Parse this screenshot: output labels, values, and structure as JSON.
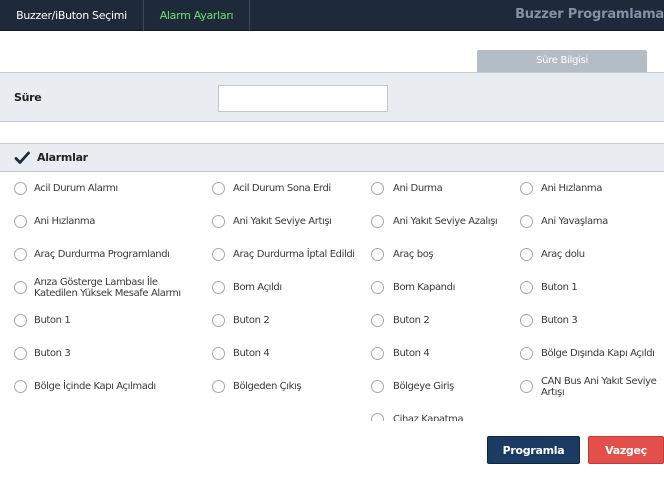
{
  "header": {
    "tabs": [
      {
        "label": "Buzzer/iButon Seçimi"
      },
      {
        "label": "Alarm Ayarları"
      }
    ],
    "title": "Buzzer Programlama"
  },
  "info_tab": {
    "label": "Süre Bilgisi"
  },
  "sure": {
    "label": "Süre",
    "value": ""
  },
  "alarms": {
    "header_label": "Alarmlar",
    "header_checked": true,
    "items": [
      "Acil Durum Alarmı",
      "Acil Durum Sona Erdi",
      "Ani Durma",
      "Ani Hızlanma",
      "Ani Hızlanma",
      "Ani Yakıt Seviye Artışı",
      "Ani Yakıt Seviye Azalışı",
      "Ani Yavaşlama",
      "Araç Durdurma Programlandı",
      "Araç Durdurma İptal Edildi",
      "Araç boş",
      "Araç dolu",
      "Arıza Gösterge Lambası İle Katedilen Yüksek Mesafe Alarmı",
      "Bom Açıldı",
      "Bom Kapandı",
      "Buton 1",
      "Buton 1",
      "Buton 2",
      "Buton 2",
      "Buton 3",
      "Buton 3",
      "Buton 4",
      "Buton 4",
      "Bölge Dışında Kapı Açıldı",
      "Bölge İçinde Kapı Açılmadı",
      "Bölgeden Çıkış",
      "Bölgeye Giriş",
      "CAN Bus Ani Yakıt Seviye Artışı",
      "",
      "",
      "Cihaz Kapatma",
      ""
    ]
  },
  "actions": {
    "programla": "Programla",
    "vazgec": "Vazgeç"
  },
  "colors": {
    "topbar": "#1e2a3a",
    "active_tab": "#6fe06f",
    "primary_button": "#1b3b63",
    "cancel_button": "#e3504c"
  }
}
